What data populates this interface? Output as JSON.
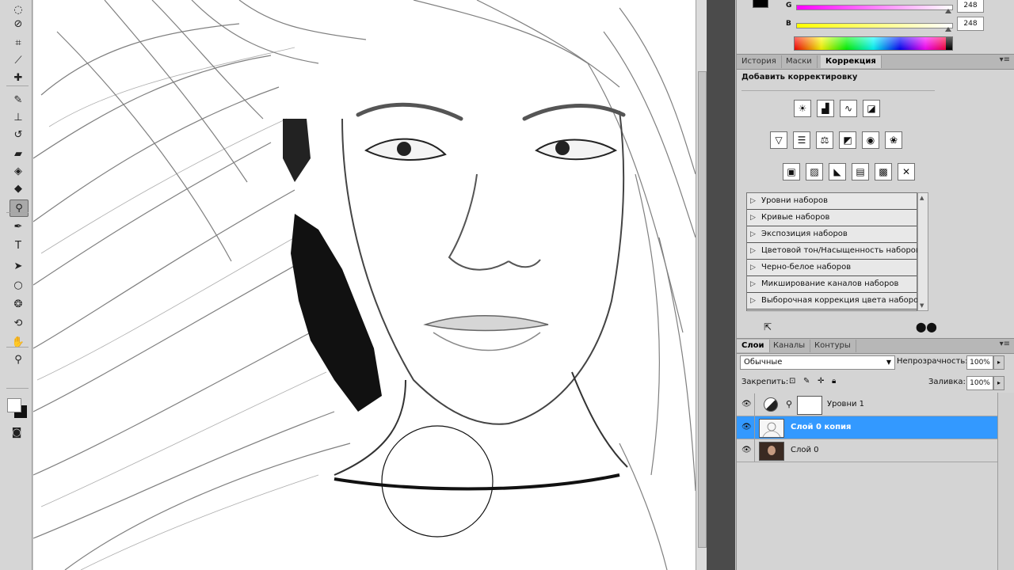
{
  "toolbar": {
    "tools": [
      {
        "name": "lasso-tool-icon",
        "glyph": "◌"
      },
      {
        "name": "quick-select-tool-icon",
        "glyph": "⊘"
      },
      {
        "name": "crop-tool-icon",
        "glyph": "⌗"
      },
      {
        "name": "eyedropper-tool-icon",
        "glyph": "⟋"
      },
      {
        "name": "healing-brush-tool-icon",
        "glyph": "✚"
      },
      {
        "name": "brush-tool-icon",
        "glyph": "✎"
      },
      {
        "name": "clone-stamp-tool-icon",
        "glyph": "⊥"
      },
      {
        "name": "history-brush-tool-icon",
        "glyph": "↺"
      },
      {
        "name": "eraser-tool-icon",
        "glyph": "▰"
      },
      {
        "name": "gradient-tool-icon",
        "glyph": "◈"
      },
      {
        "name": "blur-tool-icon",
        "glyph": "◆"
      },
      {
        "name": "dodge-tool-icon",
        "glyph": "⚲"
      },
      {
        "name": "pen-tool-icon",
        "glyph": "✒"
      },
      {
        "name": "type-tool-icon",
        "glyph": "T"
      },
      {
        "name": "path-select-tool-icon",
        "glyph": "➤"
      },
      {
        "name": "ellipse-tool-icon",
        "glyph": "○"
      },
      {
        "name": "3d-rotate-tool-icon",
        "glyph": "❂"
      },
      {
        "name": "3d-orbit-tool-icon",
        "glyph": "⟲"
      },
      {
        "name": "hand-tool-icon",
        "glyph": "✋"
      },
      {
        "name": "zoom-tool-icon",
        "glyph": "⚲"
      }
    ]
  },
  "color_panel": {
    "g_label": "G",
    "g_value": "248",
    "b_label": "B",
    "b_value": "248",
    "g_color_start": "#ff00ff",
    "g_color_end": "#ffffff",
    "b_color_start": "#ffff00",
    "b_color_end": "#ffffff"
  },
  "adjust_tabs": {
    "history": "История",
    "masks": "Маски",
    "correction": "Коррекция"
  },
  "adjustments": {
    "title": "Добавить корректировку",
    "icons_row1": [
      {
        "name": "brightness-contrast-icon",
        "glyph": "☀"
      },
      {
        "name": "levels-icon",
        "glyph": "▟"
      },
      {
        "name": "curves-icon",
        "glyph": "∿"
      },
      {
        "name": "exposure-icon",
        "glyph": "◪"
      }
    ],
    "icons_row2": [
      {
        "name": "vibrance-icon",
        "glyph": "▽"
      },
      {
        "name": "hue-saturation-icon",
        "glyph": "☰"
      },
      {
        "name": "color-balance-icon",
        "glyph": "⚖"
      },
      {
        "name": "black-white-icon",
        "glyph": "◩"
      },
      {
        "name": "photo-filter-icon",
        "glyph": "◉"
      },
      {
        "name": "channel-mixer-icon",
        "glyph": "❀"
      }
    ],
    "icons_row3": [
      {
        "name": "invert-icon",
        "glyph": "▣"
      },
      {
        "name": "posterize-icon",
        "glyph": "▨"
      },
      {
        "name": "threshold-icon",
        "glyph": "◣"
      },
      {
        "name": "gradient-map-icon",
        "glyph": "▤"
      },
      {
        "name": "selective-color-icon",
        "glyph": "▩"
      },
      {
        "name": "selective-color-x-icon",
        "glyph": "✕"
      }
    ],
    "presets": [
      "Уровни наборов",
      "Кривые наборов",
      "Экспозиция наборов",
      "Цветовой тон/Насыщенность наборов",
      "Черно-белое наборов",
      "Микширование каналов наборов",
      "Выборочная коррекция цвета наборов"
    ]
  },
  "layers_tabs": {
    "layers": "Слои",
    "channels": "Каналы",
    "paths": "Контуры"
  },
  "layers": {
    "blend_mode": "Обычные",
    "opacity_label": "Непрозрачность:",
    "opacity_value": "100%",
    "lock_label": "Закрепить:",
    "fill_label": "Заливка:",
    "fill_value": "100%",
    "list": [
      {
        "name": "Уровни 1"
      },
      {
        "name": "Слой 0 копия"
      },
      {
        "name": "Слой 0"
      }
    ]
  },
  "colors": {
    "selection": "#3399ff"
  }
}
